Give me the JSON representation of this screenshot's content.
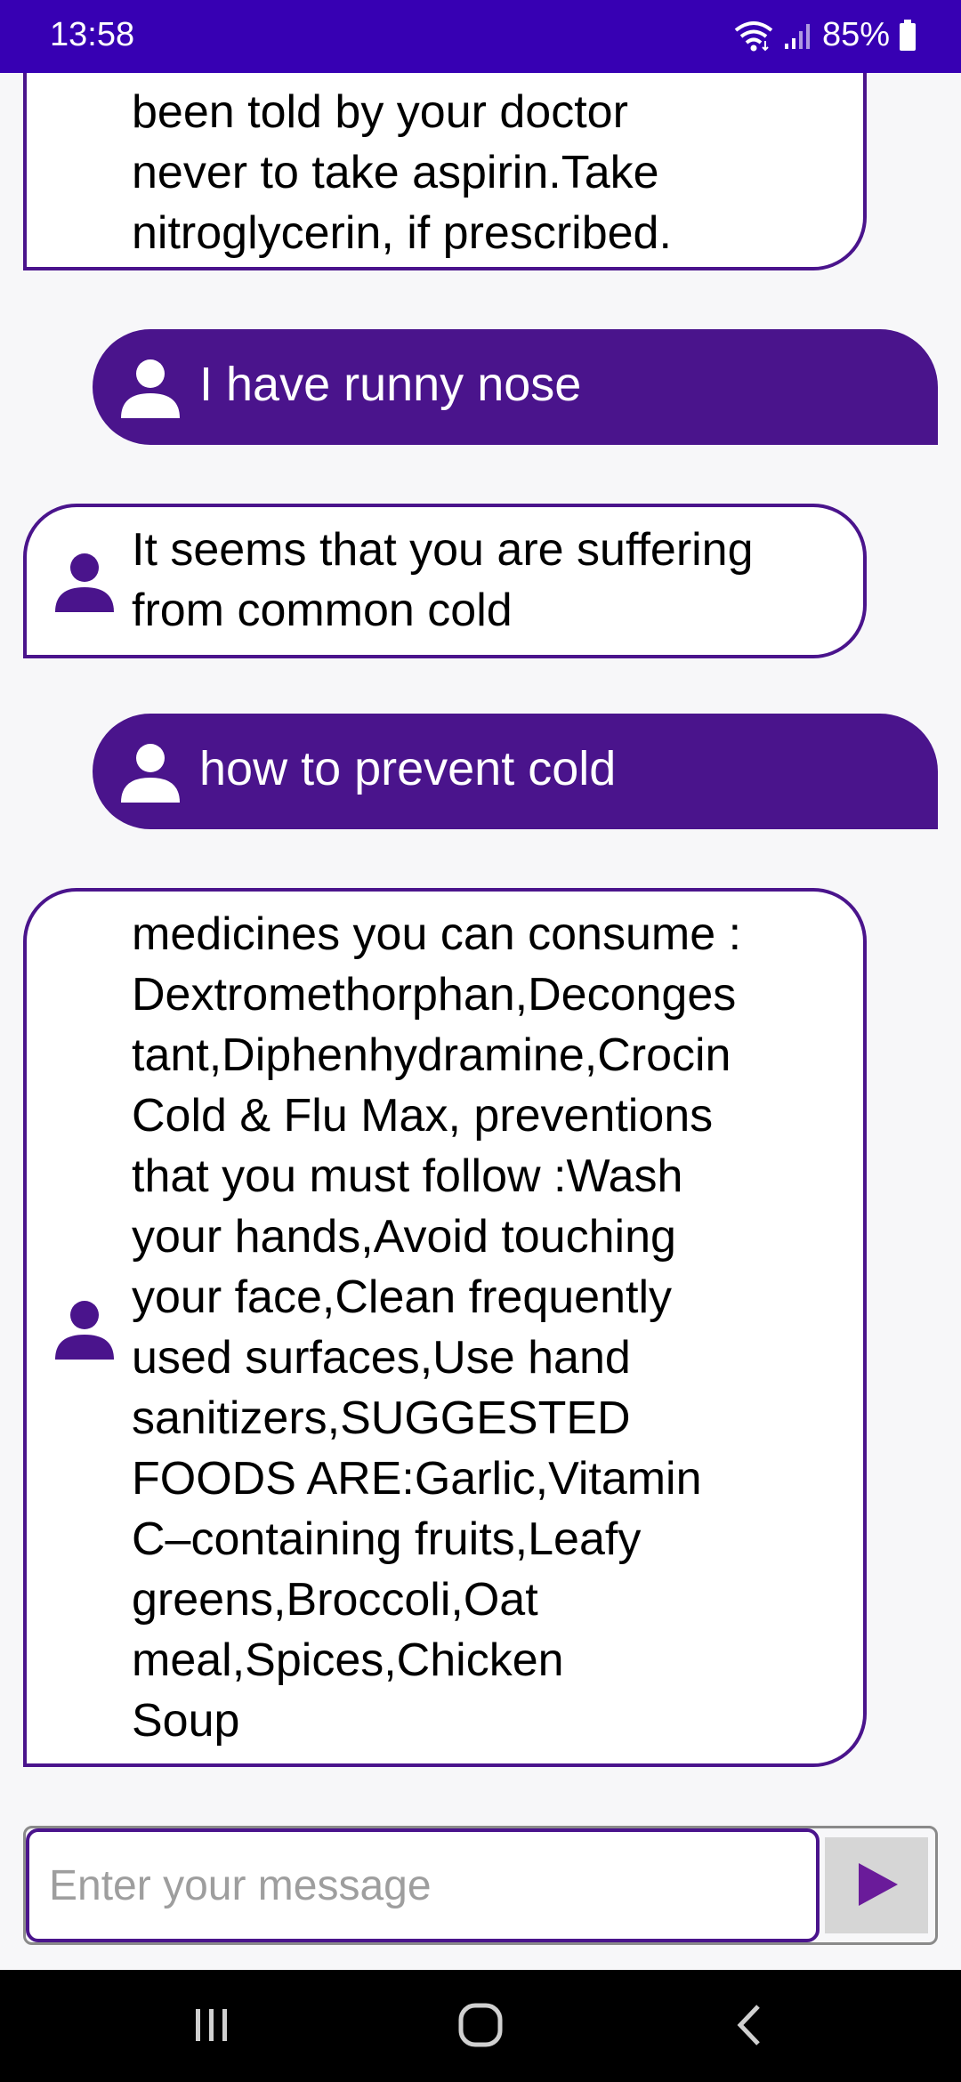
{
  "status_bar": {
    "time": "13:58",
    "battery": "85%",
    "icons": [
      "wifi-icon",
      "signal-icon",
      "battery-icon"
    ]
  },
  "messages": [
    {
      "role": "bot",
      "text": "been told by your doctor\nnever to take aspirin.Take\nnitroglycerin, if prescribed."
    },
    {
      "role": "user",
      "text": "I have runny nose"
    },
    {
      "role": "bot",
      "text": "It seems that you are suffering\nfrom common cold"
    },
    {
      "role": "user",
      "text": "how to prevent cold"
    },
    {
      "role": "bot",
      "text": "medicines you can consume :\nDextromethorphan,Deconges\ntant,Diphenhydramine,Crocin\nCold & Flu Max, preventions\nthat you must follow :Wash\nyour hands,Avoid touching\nyour face,Clean frequently\nused surfaces,Use hand\nsanitizers,SUGGESTED\nFOODS ARE:Garlic,Vitamin\nC–containing fruits,Leafy\ngreens,Broccoli,Oat\nmeal,Spices,Chicken\nSoup"
    }
  ],
  "composer": {
    "placeholder": "Enter your message",
    "value": "",
    "send_icon": "send-icon"
  },
  "nav_bar": {
    "icons": [
      "recents-icon",
      "home-icon",
      "back-icon"
    ]
  },
  "colors": {
    "status_bar": "#3700b3",
    "accent": "#4a148c",
    "background": "#f7f7f9",
    "send_button_bg": "#d6d6d6",
    "send_arrow": "#6a1b9a"
  }
}
